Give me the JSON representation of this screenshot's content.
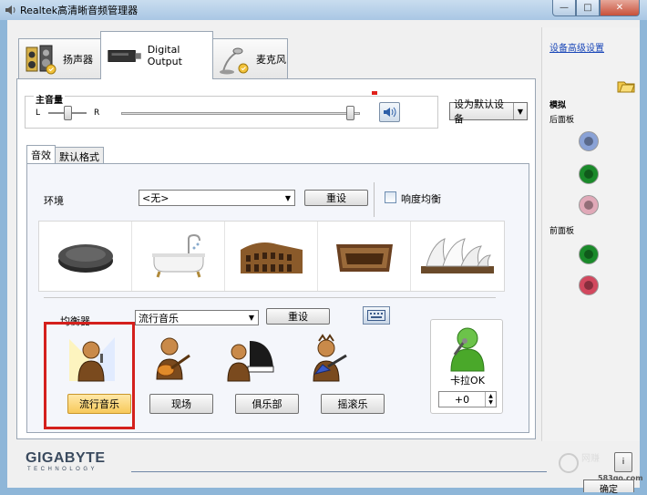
{
  "window": {
    "title": "Realtek高清晰音频管理器",
    "min": "—",
    "max": "□",
    "close": "✕"
  },
  "main_tabs": [
    {
      "label": "扬声器"
    },
    {
      "label": "Digital Output"
    },
    {
      "label": "麦克风"
    }
  ],
  "volume": {
    "title": "主音量",
    "left": "L",
    "right": "R",
    "default_device": "设为默认设备"
  },
  "sub_tabs": [
    {
      "label": "音效"
    },
    {
      "label": "默认格式"
    }
  ],
  "environment": {
    "label": "环境",
    "selected": "<无>",
    "reset": "重设",
    "loudness": "响度均衡",
    "loudness_checked": false,
    "presets": [
      "stone",
      "bathroom",
      "colosseum",
      "arena",
      "opera-house"
    ]
  },
  "equalizer": {
    "label": "均衡器",
    "selected": "流行音乐",
    "reset": "重设",
    "presets": [
      {
        "label": "流行音乐",
        "selected": true
      },
      {
        "label": "现场",
        "selected": false
      },
      {
        "label": "俱乐部",
        "selected": false
      },
      {
        "label": "摇滚乐",
        "selected": false
      }
    ]
  },
  "karaoke": {
    "label": "卡拉OK",
    "value": "+0"
  },
  "right_panel": {
    "advanced_link": "设备高级设置",
    "analog": "模拟",
    "rear_panel": "后面板",
    "front_panel": "前面板",
    "jack_colors": {
      "rear": [
        "#8aa2d6",
        "#1a8a2a",
        "#e0a9b8"
      ],
      "front": [
        "#1a8a2a",
        "#d2485e"
      ]
    }
  },
  "brand": {
    "name": "GIGABYTE",
    "tagline": "TECHNOLOGY"
  },
  "bottom": {
    "info": "i",
    "ok": "确定"
  },
  "watermark": "583go.com",
  "colors": {
    "accent_link": "#1a47b8",
    "selected_preset": "#f7c95a",
    "highlight_box": "#d4201c"
  }
}
